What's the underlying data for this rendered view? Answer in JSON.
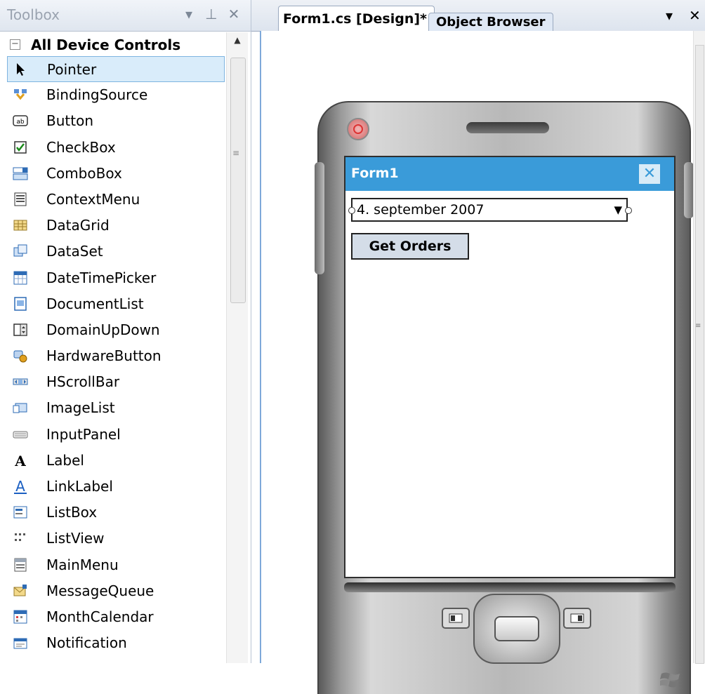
{
  "toolbox": {
    "title": "Toolbox",
    "title_buttons": [
      "▾",
      "⊥",
      "✕"
    ],
    "category": "All Device Controls",
    "items": [
      {
        "label": "Pointer",
        "icon": "pointer-icon"
      },
      {
        "label": "BindingSource",
        "icon": "bindingsource-icon"
      },
      {
        "label": "Button",
        "icon": "button-icon"
      },
      {
        "label": "CheckBox",
        "icon": "checkbox-icon"
      },
      {
        "label": "ComboBox",
        "icon": "combobox-icon"
      },
      {
        "label": "ContextMenu",
        "icon": "contextmenu-icon"
      },
      {
        "label": "DataGrid",
        "icon": "datagrid-icon"
      },
      {
        "label": "DataSet",
        "icon": "dataset-icon"
      },
      {
        "label": "DateTimePicker",
        "icon": "datetimepicker-icon"
      },
      {
        "label": "DocumentList",
        "icon": "documentlist-icon"
      },
      {
        "label": "DomainUpDown",
        "icon": "domainupdown-icon"
      },
      {
        "label": "HardwareButton",
        "icon": "hardwarebutton-icon"
      },
      {
        "label": "HScrollBar",
        "icon": "hscrollbar-icon"
      },
      {
        "label": "ImageList",
        "icon": "imagelist-icon"
      },
      {
        "label": "InputPanel",
        "icon": "inputpanel-icon"
      },
      {
        "label": "Label",
        "icon": "label-icon"
      },
      {
        "label": "LinkLabel",
        "icon": "linklabel-icon"
      },
      {
        "label": "ListBox",
        "icon": "listbox-icon"
      },
      {
        "label": "ListView",
        "icon": "listview-icon"
      },
      {
        "label": "MainMenu",
        "icon": "mainmenu-icon"
      },
      {
        "label": "MessageQueue",
        "icon": "messagequeue-icon"
      },
      {
        "label": "MonthCalendar",
        "icon": "monthcalendar-icon"
      },
      {
        "label": "Notification",
        "icon": "notification-icon"
      }
    ]
  },
  "tabs": {
    "design": "Form1.cs [Design]*",
    "browser": "Object Browser"
  },
  "form": {
    "title": "Form1",
    "close": "✕",
    "date_value": "4. september 2007",
    "button_label": "Get Orders"
  },
  "colors": {
    "form_title_bar": "#3a9bd9",
    "selection": "#d9ecfa"
  }
}
